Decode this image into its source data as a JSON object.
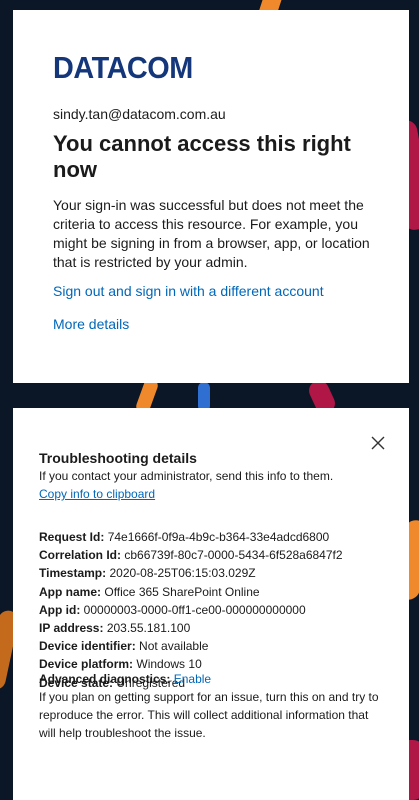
{
  "colors": {
    "brand": "#14367a",
    "link": "#0067b8",
    "background": "#0b1626"
  },
  "top_card": {
    "logo_text": "DATACOM",
    "email": "sindy.tan@datacom.com.au",
    "title": "You cannot access this right now",
    "description": "Your sign-in was successful but does not meet the criteria to access this resource. For example, you might be signing in from a browser, app, or location that is restricted by your admin.",
    "sign_out_link": "Sign out and sign in with a different account",
    "more_details_link": "More details"
  },
  "troubleshooting": {
    "close_icon": "close-icon",
    "title": "Troubleshooting details",
    "subtitle": "If you contact your administrator, send this info to them.",
    "copy_link": "Copy info to clipboard",
    "details": [
      {
        "key": "Request Id:",
        "value": "74e1666f-0f9a-4b9c-b364-33e4adcd6800"
      },
      {
        "key": "Correlation Id:",
        "value": "cb66739f-80c7-0000-5434-6f528a6847f2"
      },
      {
        "key": "Timestamp:",
        "value": "2020-08-25T06:15:03.029Z"
      },
      {
        "key": "App name:",
        "value": "Office 365 SharePoint Online"
      },
      {
        "key": "App id:",
        "value": "00000003-0000-0ff1-ce00-000000000000"
      },
      {
        "key": "IP address:",
        "value": "203.55.181.100"
      },
      {
        "key": "Device identifier:",
        "value": "Not available"
      },
      {
        "key": "Device platform:",
        "value": "Windows 10"
      },
      {
        "key": "Device state:",
        "value": "Unregistered"
      }
    ],
    "advanced_label": "Advanced diagnostics:",
    "enable_link": "Enable",
    "advanced_text": "If you plan on getting support for an issue, turn this on and try to reproduce the error. This will collect additional information that will help troubleshoot the issue."
  }
}
